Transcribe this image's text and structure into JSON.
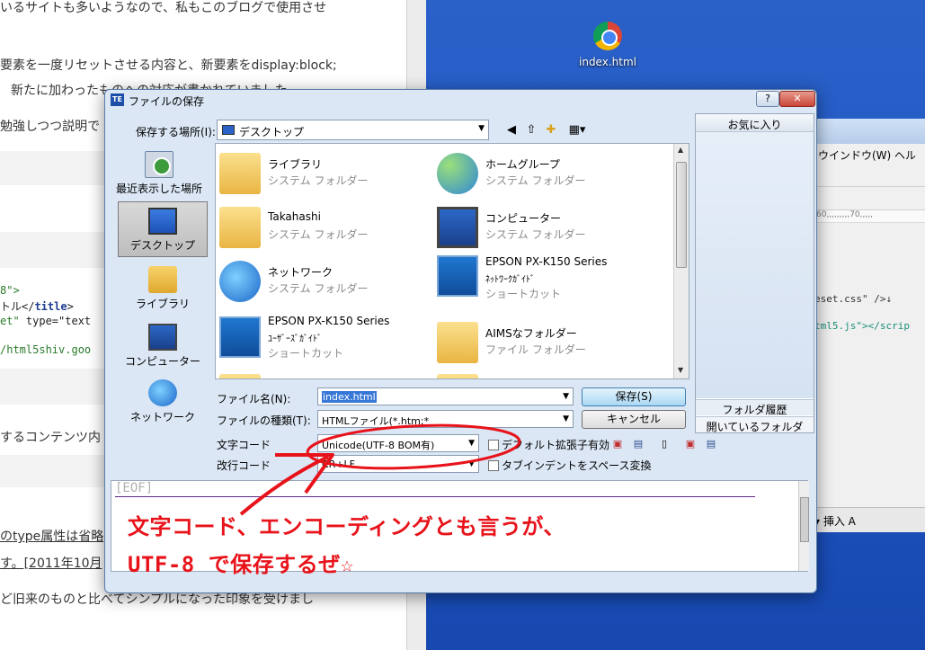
{
  "background_page": {
    "lines": [
      "いるサイトも多いようなので、私もこのブログで使用させ",
      "要素を一度リセットさせる内容と、新要素をdisplay:block;",
      "新たに加わったものへの対応が書かれていました。",
      "勉強しつつ説明で",
      "するコンテンツ内",
      "のtype属性は省略",
      "す。[2011年10月",
      "ど旧来のものと比べてシンプルになった印象を受けまし"
    ],
    "code": {
      "c1": "8\">",
      "c2a": "トル</",
      "c2b": "title",
      "c2c": ">",
      "c3a": "et\"",
      "c3b": " type=\"text",
      "c4": "/html5shiv.goo"
    }
  },
  "desktop": {
    "icon_label": "index.html",
    "icon_name": "chrome-icon"
  },
  "editor_window": {
    "menu": "ウインドウ(W)  ヘル",
    "ruler": "60,,,,,,,,,70,,,,,",
    "code_line1": "eset.css\"  />↓",
    "code_line2": "tml5.js\"></scrip",
    "bottom": "▾  挿入  A"
  },
  "dialog": {
    "title": "ファイルの保存",
    "app_icon_text": "TE",
    "help_btn": "?",
    "close_btn": "✕",
    "save_in_label": "保存する場所(I):",
    "save_in_value": "デスクトップ",
    "places": [
      {
        "label": "最近表示した場所",
        "icon": "recent-places-icon"
      },
      {
        "label": "デスクトップ",
        "icon": "desktop-icon"
      },
      {
        "label": "ライブラリ",
        "icon": "library-icon"
      },
      {
        "label": "コンピューター",
        "icon": "computer-icon"
      },
      {
        "label": "ネットワーク",
        "icon": "network-icon"
      }
    ],
    "files": [
      {
        "name": "ライブラリ",
        "type": "システム フォルダー",
        "icon": "library-folder-icon"
      },
      {
        "name": "ホームグループ",
        "type": "システム フォルダー",
        "icon": "homegroup-icon"
      },
      {
        "name": "Takahashi",
        "type": "システム フォルダー",
        "icon": "user-folder-icon"
      },
      {
        "name": "コンピューター",
        "type": "システム フォルダー",
        "icon": "computer-icon"
      },
      {
        "name": "ネットワーク",
        "type": "システム フォルダー",
        "icon": "network-icon"
      },
      {
        "name": "EPSON PX-K150 Series",
        "sub": "ﾈｯﾄﾜｰｸｶﾞｲﾄﾞ",
        "type": "ショートカット",
        "icon": "printer-shortcut-icon"
      },
      {
        "name": "EPSON PX-K150 Series",
        "sub": "ﾕｰｻﾞｰｽﾞｶﾞｲﾄﾞ",
        "type": "ショートカット",
        "icon": "printer-shortcut-icon"
      },
      {
        "name": "AIMSなフォルダー",
        "type": "ファイル フォルダー",
        "icon": "folder-icon"
      }
    ],
    "favorites_header": "お気に入り",
    "history_btn": "フォルダ履歴",
    "open_folders_btn": "開いているフォルダ",
    "filename_label": "ファイル名(N):",
    "filename_value": "index.html",
    "filetype_label": "ファイルの種類(T):",
    "filetype_value": "HTMLファイル(*.htm;*",
    "encoding_label": "文字コード",
    "encoding_value": "Unicode(UTF-8 BOM有)",
    "linebreak_label": "改行コード",
    "linebreak_value": "CR+LF",
    "save_btn": "保存(S)",
    "cancel_btn": "キャンセル",
    "default_ext_label": "デフォルト拡張子有効",
    "tab_indent_label": "タブインデントをスペース変換",
    "eof_text": "[EOF]"
  },
  "annotation": {
    "line1": "文字コード、エンコーディングとも言うが、",
    "line2": "UTF-8 で保存するぜ☆",
    "color": "#e8131a"
  }
}
